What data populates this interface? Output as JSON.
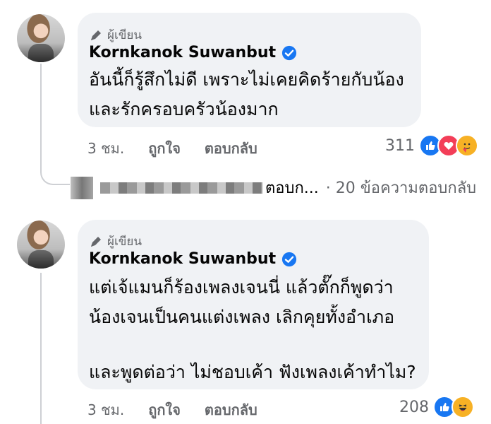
{
  "comments": [
    {
      "author_tag": "ผู้เขียน",
      "name": "Kornkanok Suwanbut",
      "lines": [
        "อันนี้ก็รู้สึกไม่ดี เพราะไม่เคยคิดร้ายกับน้อง",
        "และรักครอบครัวน้องมาก"
      ],
      "time": "3 ชม.",
      "like_label": "ถูกใจ",
      "reply_label": "ตอบกลับ",
      "reaction_count": "311",
      "reactions": [
        "like-icon",
        "love-icon",
        "care-icon"
      ]
    },
    {
      "author_tag": "ผู้เขียน",
      "name": "Kornkanok Suwanbut",
      "lines": [
        "แต่เจ้แมนก็ร้องเพลงเจนนี่ แล้วตั๊กก็พูดว่า",
        "น้องเจนเป็นคนแต่งเพลง เลิกคุยทั้งอำเภอ",
        "",
        "และพูดต่อว่า ไม่ชอบเค้า ฟังเพลงเค้าทำไม?"
      ],
      "time": "3 ชม.",
      "like_label": "ถูกใจ",
      "reply_label": "ตอบกลับ",
      "reaction_count": "208",
      "reactions": [
        "like-icon",
        "haha-icon"
      ]
    }
  ],
  "reply_preview": {
    "truncated_text": "ตอบก...",
    "count_text": "· 20 ข้อความตอบกลับ"
  },
  "colors": {
    "bubble": "#f0f2f5",
    "meta": "#65676b",
    "verified": "#1877f2"
  }
}
